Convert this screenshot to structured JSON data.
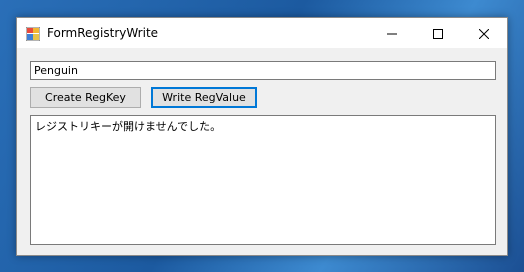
{
  "window": {
    "title": "FormRegistryWrite",
    "app_icon": "winforms-app-icon",
    "controls": {
      "minimize_icon": "minimize-icon",
      "maximize_icon": "maximize-icon",
      "close_icon": "close-icon"
    }
  },
  "form": {
    "key_input_value": "Penguin",
    "create_button_label": "Create RegKey",
    "write_button_label": "Write RegValue",
    "output_text": "レジストリキーが開けませんでした。"
  },
  "colors": {
    "focus_accent": "#0078d7",
    "window_background": "#f0f0f0",
    "titlebar_background": "#ffffff",
    "desktop_background": "#1e5fa8"
  }
}
